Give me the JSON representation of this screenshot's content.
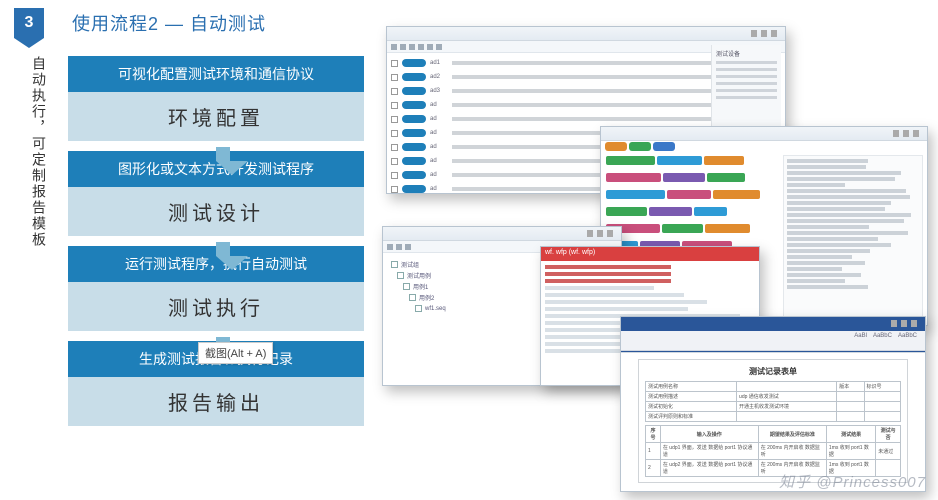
{
  "header": {
    "badge": "3",
    "title": "使用流程2 — 自动测试"
  },
  "sidebar_text": "自动执行，可定制报告模板",
  "flow": [
    {
      "desc": "可视化配置测试环境和通信协议",
      "title": "环境配置"
    },
    {
      "desc": "图形化或文本方式开发测试程序",
      "title": "测试设计"
    },
    {
      "desc": "运行测试程序，执行自动测试",
      "title": "测试执行"
    },
    {
      "desc": "生成测试报告、执行记录",
      "title": "报告输出"
    }
  ],
  "tooltip": "截图(Alt + A)",
  "screenshots": {
    "env_config": {
      "rows": [
        {
          "label": "ad1"
        },
        {
          "label": "ad2"
        },
        {
          "label": "ad3"
        },
        {
          "label": "ad"
        },
        {
          "label": "ad"
        },
        {
          "label": "ad"
        },
        {
          "label": "ad"
        },
        {
          "label": "ad"
        },
        {
          "label": "ad"
        },
        {
          "label": "ad"
        }
      ],
      "side": {
        "title": "测试设备"
      }
    },
    "design": {
      "toolbar_colors": [
        "#e08b2e",
        "#3aa655",
        "#3a78c8"
      ],
      "tag_colors": [
        "#3aa655",
        "#2e9bd6",
        "#e08b2e",
        "#c94f7c",
        "#7a5ab0",
        "#3aa655",
        "#2e9bd6",
        "#c94f7c",
        "#e08b2e",
        "#3aa655",
        "#7a5ab0",
        "#2e9bd6",
        "#c94f7c",
        "#3aa655",
        "#e08b2e",
        "#2e9bd6",
        "#7a5ab0",
        "#c94f7c"
      ],
      "code_lines": 22
    },
    "tree": {
      "items": [
        "测试组",
        "测试用例",
        "用例1",
        "用例2",
        "wf1.seq"
      ]
    },
    "script": {
      "header": "wf. wfp (wf. wfp)",
      "red_lines": 3,
      "gray_lines": 10
    },
    "report": {
      "ribbon_styles": [
        "AaBl",
        "AaBbC",
        "AaBbC"
      ],
      "doc_title": "测试记录表单",
      "meta_rows": [
        [
          "测试用例名称",
          "",
          "版本",
          "标识号"
        ],
        [
          "测试用例描述",
          "udp 通信收发测试",
          "",
          ""
        ],
        [
          "测试初始化",
          "开通主机收发测试环境",
          "",
          ""
        ],
        [
          "测试评判原则和标准",
          "",
          "",
          ""
        ]
      ],
      "step_header": [
        "序号",
        "输入及操作",
        "期望结果及评估标准",
        "测试结果",
        "测试与否"
      ],
      "steps": [
        [
          "1",
          "在 udp1 界面，发送 数据给 port1 协议通道",
          "在 200ms 内开启收 数据监听",
          "1ms 收到 port1 数据",
          "未通过"
        ],
        [
          "2",
          "在 udp2 界面，发送 数据给 port1 协议通道",
          "在 200ms 内开启收 数据监听",
          "1ms 收到 port1 数据",
          ""
        ]
      ]
    }
  },
  "watermark": "知乎 @Princess007"
}
